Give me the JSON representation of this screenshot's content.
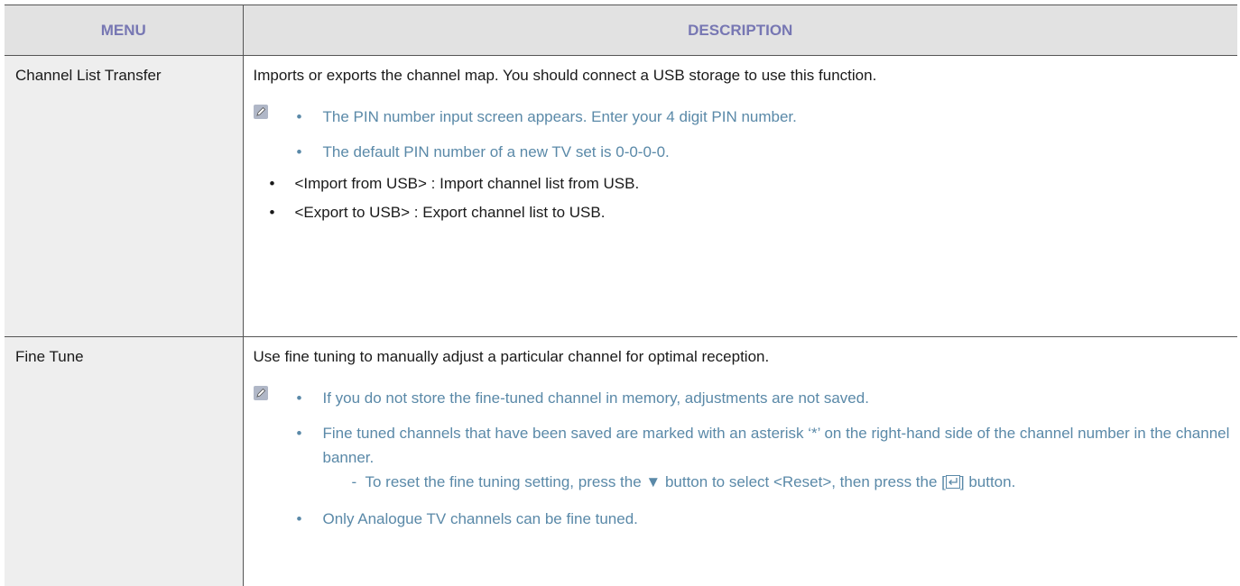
{
  "header": {
    "menu": "MENU",
    "description": "DESCRIPTION"
  },
  "rows": [
    {
      "menu": "Channel List Transfer",
      "intro": "Imports or exports the channel map. You should connect a USB storage to use this function.",
      "notes": [
        "The PIN number input screen appears. Enter your 4 digit PIN number.",
        "The default PIN number of a new TV set is 0-0-0-0."
      ],
      "items": [
        "<Import from USB> : Import channel list from USB.",
        "<Export to USB> : Export channel list to USB."
      ]
    },
    {
      "menu": "Fine Tune",
      "intro": "Use fine tuning to manually adjust a particular channel for optimal reception.",
      "notes": [
        "If you do not store the fine-tuned channel in memory, adjustments are not saved.",
        "Fine tuned channels that have been saved are marked with an asterisk ‘*’ on the right-hand side of the channel number in the channel banner.",
        "Only Analogue TV channels can be fine tuned."
      ],
      "sub": {
        "prefix": "To reset the fine tuning setting, press the ▼ button to select <Reset>, then press the [",
        "suffix": "] button."
      }
    }
  ],
  "bullet": "•",
  "dash": "-",
  "icons": {
    "note": "note-pencil-icon",
    "enter": "enter-key-icon"
  },
  "colors": {
    "header_text": "#7777b3",
    "note_text": "#5a89a8",
    "header_bg": "#e2e2e2",
    "menu_bg": "#eeeeee"
  }
}
